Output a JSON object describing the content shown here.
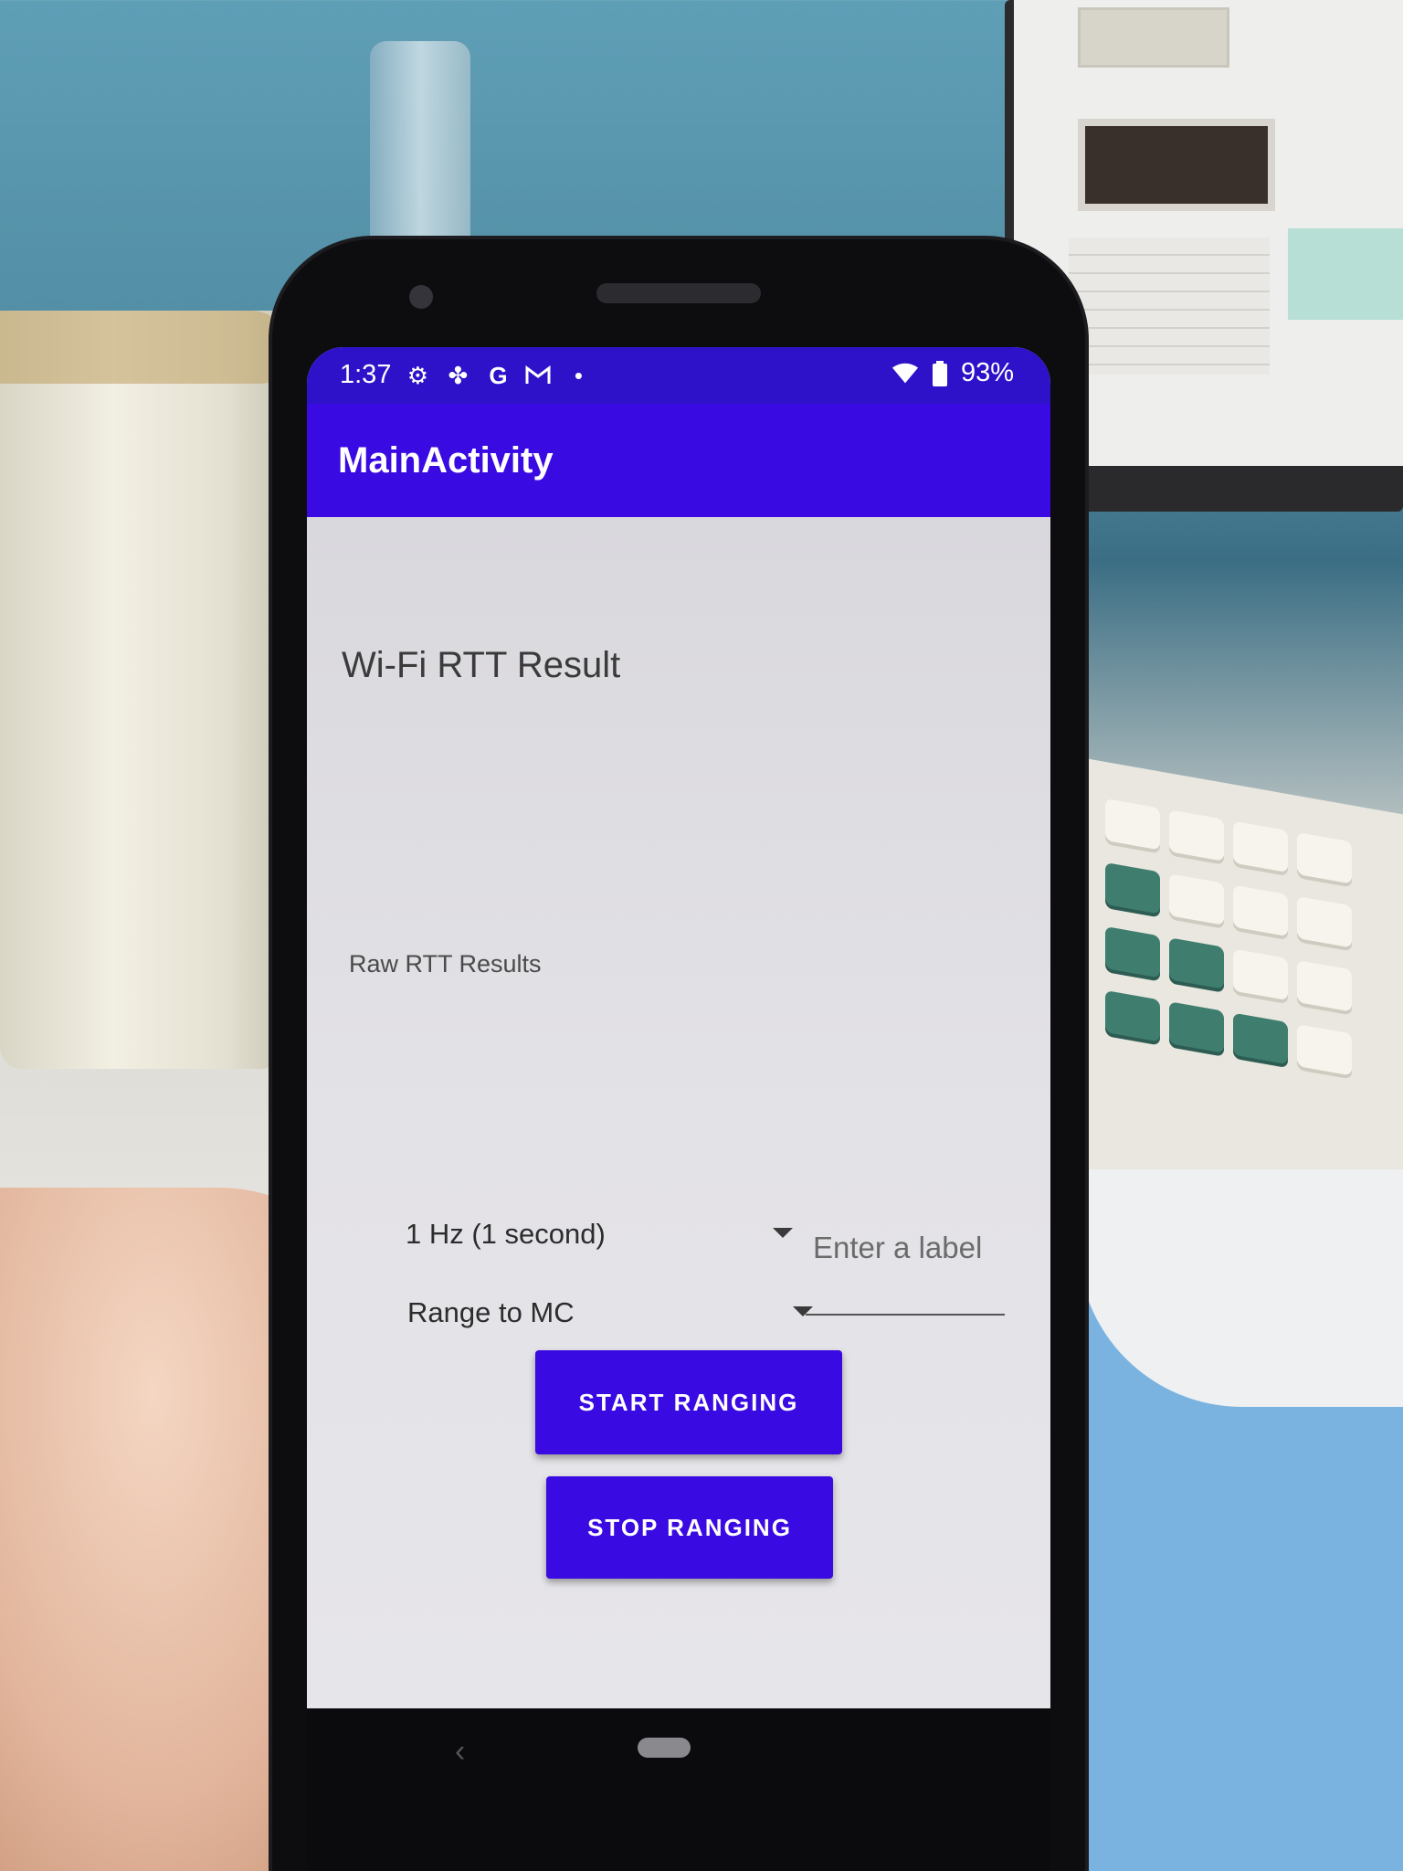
{
  "status_bar": {
    "time": "1:37",
    "icons_left": [
      "settings-icon",
      "fan-icon",
      "google-icon",
      "gmail-icon",
      "dot-icon"
    ],
    "battery": "93%"
  },
  "app_bar": {
    "title": "MainActivity"
  },
  "main": {
    "heading": "Wi-Fi RTT Result",
    "raw_results_label": "Raw RTT Results",
    "frequency_spinner": {
      "selected": "1 Hz (1 second)"
    },
    "mode_spinner": {
      "selected": "Range to MC"
    },
    "label_input": {
      "placeholder": "Enter a label",
      "value": ""
    },
    "start_button": "START RANGING",
    "stop_button": "STOP RANGING"
  },
  "colors": {
    "status_bar": "#2d12c9",
    "app_bar": "#3a0ae2",
    "button": "#3a0ae2",
    "content_background": "#e3e2e6"
  }
}
